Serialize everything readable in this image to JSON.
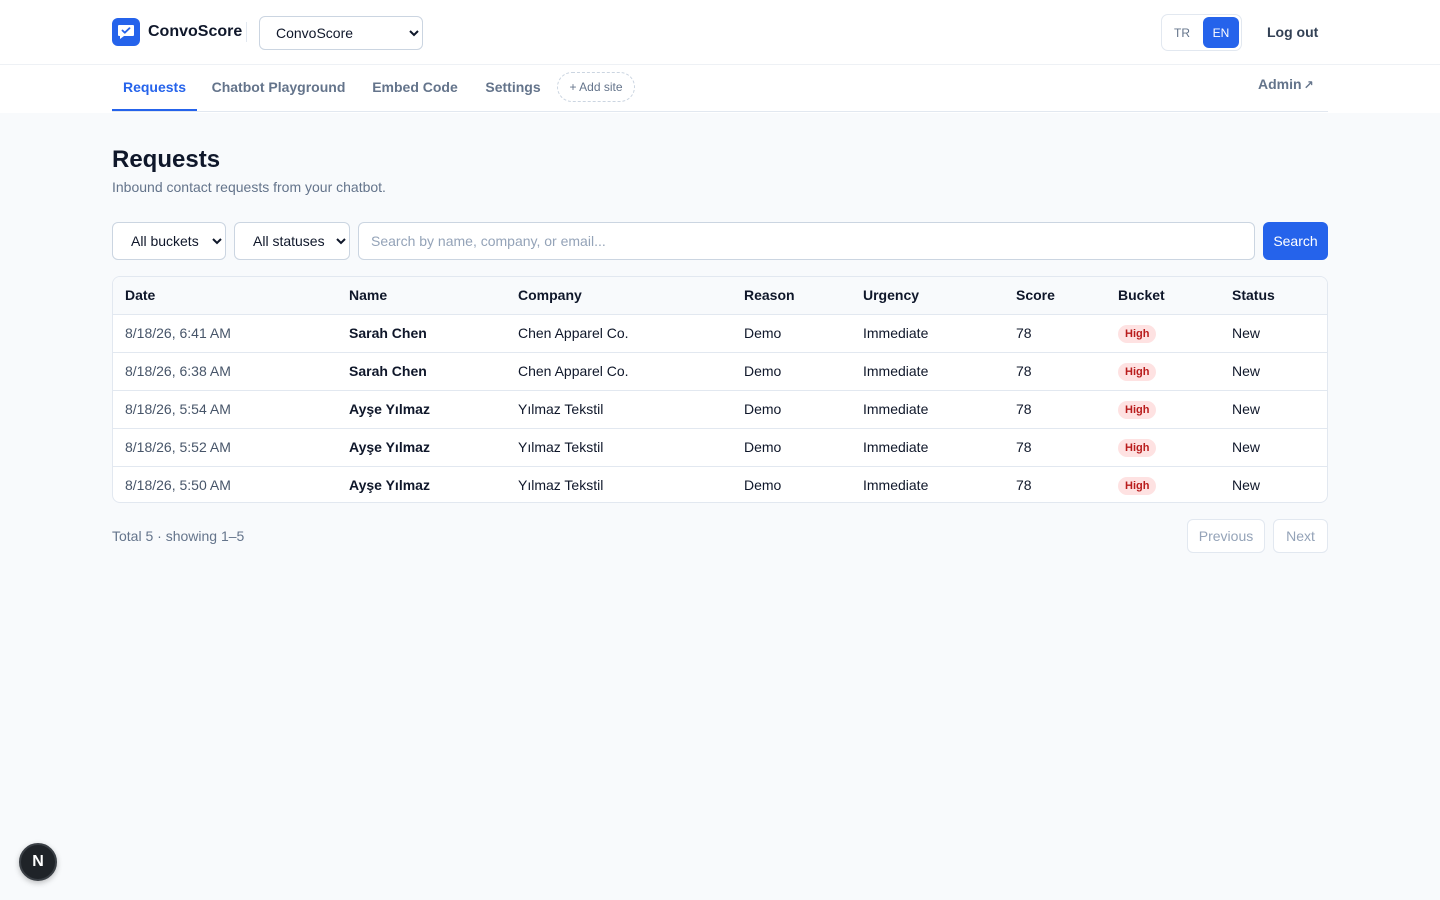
{
  "brand": {
    "name": "ConvoScore",
    "icon": "chat-check-icon",
    "color": "#2563eb"
  },
  "site_select": {
    "value": "ConvoScore",
    "options": [
      "ConvoScore"
    ]
  },
  "language": {
    "options": [
      "TR",
      "EN"
    ],
    "active": "EN"
  },
  "header": {
    "logout_label": "Log out"
  },
  "nav": {
    "tabs": [
      {
        "label": "Requests",
        "active": true
      },
      {
        "label": "Chatbot Playground",
        "active": false
      },
      {
        "label": "Embed Code",
        "active": false
      },
      {
        "label": "Settings",
        "active": false
      }
    ],
    "add_site_label": "+ Add site",
    "admin_label": "Admin",
    "admin_icon": "external-link-icon"
  },
  "page": {
    "title": "Requests",
    "subtitle": "Inbound contact requests from your chatbot."
  },
  "filters": {
    "bucket": {
      "value": "All buckets",
      "options": [
        "All buckets"
      ]
    },
    "status": {
      "value": "All statuses",
      "options": [
        "All statuses"
      ]
    },
    "search_placeholder": "Search by name, company, or email...",
    "search_label": "Search"
  },
  "table": {
    "columns": [
      "Date",
      "Name",
      "Company",
      "Reason",
      "Urgency",
      "Score",
      "Bucket",
      "Status"
    ],
    "rows": [
      {
        "date": "8/18/26, 6:41 AM",
        "name": "Sarah Chen",
        "company": "Chen Apparel Co.",
        "reason": "Demo",
        "urgency": "Immediate",
        "score": "78",
        "bucket": "High",
        "status": "New"
      },
      {
        "date": "8/18/26, 6:38 AM",
        "name": "Sarah Chen",
        "company": "Chen Apparel Co.",
        "reason": "Demo",
        "urgency": "Immediate",
        "score": "78",
        "bucket": "High",
        "status": "New"
      },
      {
        "date": "8/18/26, 5:54 AM",
        "name": "Ayşe Yılmaz",
        "company": "Yılmaz Tekstil",
        "reason": "Demo",
        "urgency": "Immediate",
        "score": "78",
        "bucket": "High",
        "status": "New"
      },
      {
        "date": "8/18/26, 5:52 AM",
        "name": "Ayşe Yılmaz",
        "company": "Yılmaz Tekstil",
        "reason": "Demo",
        "urgency": "Immediate",
        "score": "78",
        "bucket": "High",
        "status": "New"
      },
      {
        "date": "8/18/26, 5:50 AM",
        "name": "Ayşe Yılmaz",
        "company": "Yılmaz Tekstil",
        "reason": "Demo",
        "urgency": "Immediate",
        "score": "78",
        "bucket": "High",
        "status": "New"
      }
    ]
  },
  "pagination": {
    "summary": "Total 5 · showing 1–5",
    "previous_label": "Previous",
    "next_label": "Next"
  },
  "dev_badge": {
    "label": "N"
  },
  "colors": {
    "accent": "#2563eb",
    "high_badge_bg": "#fee2e2",
    "high_badge_text": "#b91c1c"
  }
}
